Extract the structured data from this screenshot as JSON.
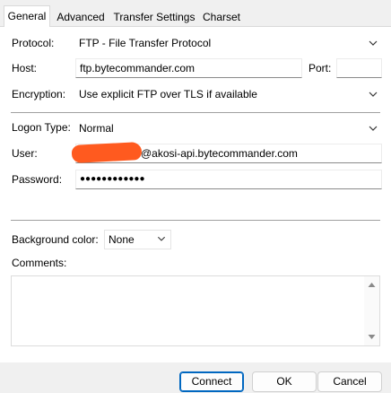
{
  "tabs": [
    {
      "label": "General",
      "active": true
    },
    {
      "label": "Advanced",
      "active": false
    },
    {
      "label": "Transfer Settings",
      "active": false
    },
    {
      "label": "Charset",
      "active": false
    }
  ],
  "form": {
    "protocol_label": "Protocol:",
    "protocol_value": "FTP - File Transfer Protocol",
    "host_label": "Host:",
    "host_value": "ftp.bytecommander.com",
    "port_label": "Port:",
    "port_value": "",
    "encryption_label": "Encryption:",
    "encryption_value": "Use explicit FTP over TLS if available",
    "logon_type_label": "Logon Type:",
    "logon_type_value": "Normal",
    "user_label": "User:",
    "user_value": "@akosi-api.bytecommander.com",
    "password_label": "Password:",
    "password_value": "●●●●●●●●●●●●",
    "bg_color_label": "Background color:",
    "bg_color_value": "None",
    "comments_label": "Comments:",
    "comments_value": ""
  },
  "buttons": {
    "connect": "Connect",
    "ok": "OK",
    "cancel": "Cancel"
  },
  "colors": {
    "redaction": "#ff5a1f",
    "default_button_border": "#0067c0"
  },
  "icons": [
    "chevron-down-icon",
    "scroll-up-icon",
    "scroll-down-icon"
  ]
}
